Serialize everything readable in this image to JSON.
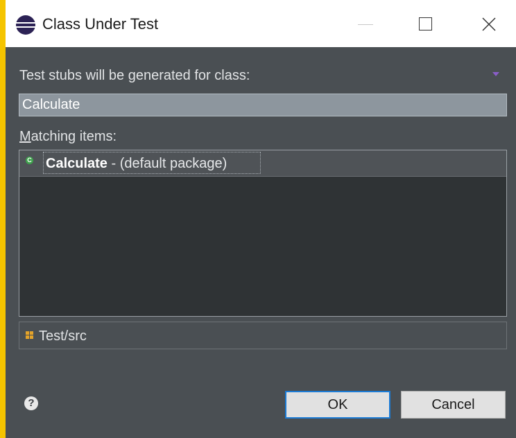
{
  "window": {
    "title": "Class Under Test",
    "icon": "eclipse-icon"
  },
  "dialog": {
    "stubs_label": "Test stubs will be generated for class:",
    "class_value": "Calculate",
    "matching_label_mnemonic": "M",
    "matching_label_rest": "atching items:",
    "items": [
      {
        "icon": "class-icon",
        "icon_glyph": "C",
        "name": "Calculate",
        "detail": " - (default package)"
      }
    ],
    "source_folder": "Test/src"
  },
  "buttons": {
    "help_glyph": "?",
    "ok_label": "OK",
    "cancel_label": "Cancel"
  },
  "colors": {
    "accent": "#1a7bd6",
    "dialog_bg": "#4a4f53",
    "list_bg": "#2f3335",
    "class_icon": "#3fa34d",
    "package_icon": "#e3a32a"
  }
}
